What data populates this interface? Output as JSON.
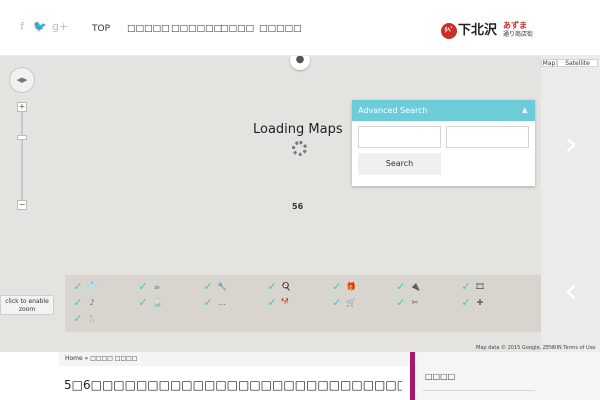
{
  "social": {
    "facebook_icon": "f",
    "twitter_icon": "🐦",
    "googleplus_icon": "g+"
  },
  "nav": {
    "items": [
      {
        "label": "TOP"
      },
      {
        "label": "□□□□□"
      },
      {
        "label": "□□□□□□"
      },
      {
        "label": "□□□□"
      },
      {
        "label": "□□□□□"
      }
    ]
  },
  "logo": {
    "mark": "ﾀﾍﾞ",
    "kanji": "下北沢",
    "red_text": "あずま",
    "sub_text": "通り商店街"
  },
  "map": {
    "loading_text": "Loading Maps",
    "number_label": "56",
    "maptype_map": "Map",
    "maptype_satellite": "Satellite",
    "click_to_zoom": "click to enable zoom",
    "attribution": "Map data © 2015 Google, ZENRIN  Terms of Use",
    "zoom_in": "+",
    "zoom_out": "−",
    "next_arrow": "›",
    "prev_arrow": "‹"
  },
  "search": {
    "title": "Advanced Search",
    "toggle": "▲",
    "input1_value": "",
    "input2_value": "",
    "button_label": "Search"
  },
  "categories": {
    "items": [
      {
        "icon": "👕",
        "icon_name": "shirt-icon"
      },
      {
        "icon": "☕",
        "icon_name": "coffee-icon"
      },
      {
        "icon": "🔧",
        "icon_name": "tool-icon"
      },
      {
        "icon": "🍳",
        "icon_name": "pot-icon"
      },
      {
        "icon": "🎁",
        "icon_name": "gift-icon"
      },
      {
        "icon": "🔌",
        "icon_name": "plug-icon"
      },
      {
        "icon": "🎞",
        "icon_name": "film-icon"
      },
      {
        "icon": "♪",
        "icon_name": "music-icon"
      },
      {
        "icon": "🍶",
        "icon_name": "bottle-icon"
      },
      {
        "icon": "…",
        "icon_name": "more-icon"
      },
      {
        "icon": "🐕",
        "icon_name": "dog-icon"
      },
      {
        "icon": "🛒",
        "icon_name": "cart-icon"
      },
      {
        "icon": "✂",
        "icon_name": "scissors-icon"
      },
      {
        "icon": "✚",
        "icon_name": "plus-icon"
      },
      {
        "icon": "🍴",
        "icon_name": "cutlery-icon"
      }
    ]
  },
  "content": {
    "breadcrumb": "Home »  □□□□  □□□□",
    "post_title": "5□6□□□□□□□□□□□□□□□□□□□□□□□□□□□□□□□□□□□□□□□□□□□",
    "sidebar_heading": "□□□□"
  },
  "colors": {
    "accent_teal": "#6ccdd8",
    "check_green": "#42c7b2",
    "sidebar_accent": "#a81a68",
    "logo_red": "#c9302c"
  }
}
